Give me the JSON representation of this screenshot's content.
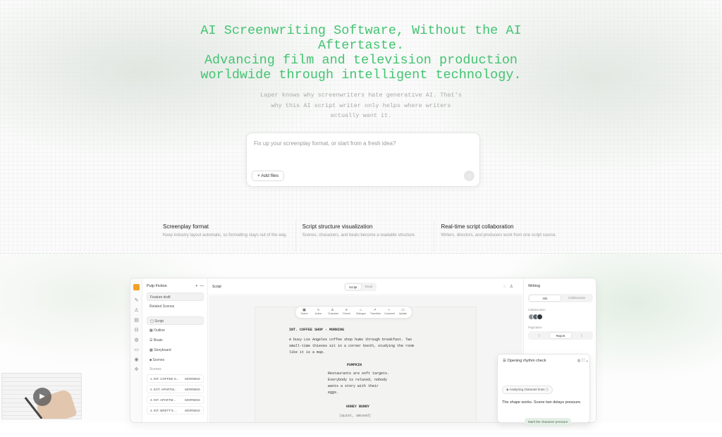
{
  "hero": {
    "title_line1": "AI Screenwriting Software, Without the AI",
    "title_line2": "Aftertaste.",
    "title_line3": "Advancing film and television production",
    "title_line4": "worldwide through intelligent technology.",
    "sub_line1": "Laper knows why screenwriters hate generative AI. That's",
    "sub_line2": "why this AI script writer only helps where writers",
    "sub_line3": "actually want it.",
    "accent_color": "#44c472"
  },
  "prompt": {
    "placeholder": "Fix up your screenplay format, or start from a fresh idea?",
    "add_files_label": "+ Add files",
    "send_icon": "arrow-up-icon"
  },
  "features": [
    {
      "title": "Screenplay format",
      "desc": "Keep industry layout automatic, so formatting stays out of the way."
    },
    {
      "title": "Script structure visualization",
      "desc": "Scenes, characters, and beats become a readable structure."
    },
    {
      "title": "Real-time script collaboration",
      "desc": "Writers, directors, and producers work from one script source."
    }
  ],
  "app": {
    "project_name": "Pulp Fiction",
    "sidebar_items": [
      "Feature draft",
      "Related Scenes"
    ],
    "nav_items": [
      "Script",
      "Outline",
      "Beats",
      "Storyboard",
      "Scenes"
    ],
    "scenes_label": "Scenes",
    "scenes": [
      {
        "name": "1. INT. COFFEE S...",
        "time": "MORNING"
      },
      {
        "name": "2. EXT. APARTM...",
        "time": "MORNING"
      },
      {
        "name": "3. INT. APARTM...",
        "time": "MORNING"
      },
      {
        "name": "4. INT. BRETT'S ...",
        "time": "MORNING"
      }
    ],
    "main_title": "Script",
    "view_toggle": [
      "Script",
      "Read"
    ],
    "tools": [
      "Scene",
      "Action",
      "Character",
      "Parent",
      "Dialogue",
      "Transition",
      "Comment",
      "Update"
    ],
    "script": {
      "heading": "INT. COFFEE SHOP - MORNING",
      "action_1": "A busy Los Angeles coffee shop hums through breakfast. Two",
      "action_2": "small-time thieves sit in a corner booth, studying the room",
      "action_3": "like it is a map.",
      "char_1": "PUMPKIN",
      "dlg_1": "Restaurants are soft targets.",
      "dlg_2": "Everybody is relaxed, nobody",
      "dlg_3": "wants a story with their",
      "dlg_4": "eggs.",
      "char_2": "HONEY BUNNY",
      "paren": "(quiet, amused)"
    },
    "right_panel": {
      "title": "Writing",
      "tabs": [
        "Info",
        "Collaboration"
      ],
      "collab_label": "Collaboration",
      "pagination_label": "Pagination",
      "pagination": [
        "",
        "Report",
        ""
      ]
    }
  },
  "popup": {
    "title": "Opening rhythm check",
    "pill": "Analyzing character lines",
    "text": "The shape works. Scene two delays pressure.",
    "button": "Mark the character pressure"
  }
}
